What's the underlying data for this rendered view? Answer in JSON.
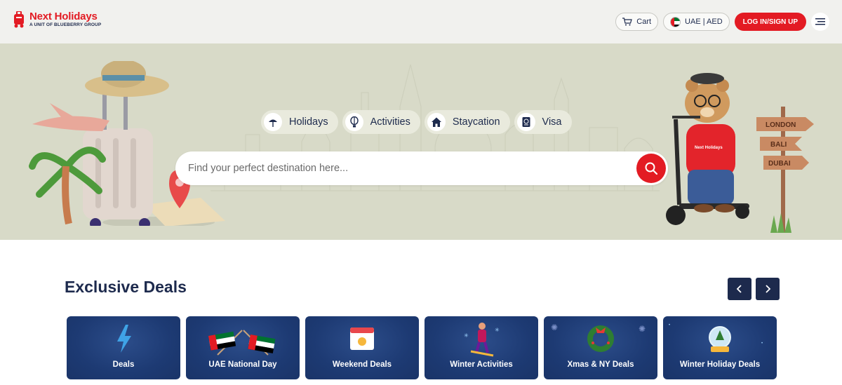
{
  "brand": {
    "name": "Next Holidays",
    "tagline": "A UNIT OF BLUEBERRY GROUP"
  },
  "header": {
    "cart_label": "Cart",
    "region_label": "UAE | AED",
    "login_label": "LOG IN/SIGN UP"
  },
  "hero": {
    "tabs": [
      {
        "label": "Holidays",
        "icon": "beach-umbrella-icon"
      },
      {
        "label": "Activities",
        "icon": "hot-air-balloon-icon"
      },
      {
        "label": "Staycation",
        "icon": "home-icon"
      },
      {
        "label": "Visa",
        "icon": "passport-icon"
      }
    ],
    "search": {
      "placeholder": "Find your perfect destination here..."
    },
    "signpost": [
      "LONDON",
      "BALI",
      "DUBAI"
    ],
    "mascot_shirt_text": "Next Holidays"
  },
  "deals": {
    "title": "Exclusive Deals",
    "cards": [
      {
        "label": "Deals",
        "icon": "lightning-icon"
      },
      {
        "label": "UAE National Day",
        "icon": "uae-flags-icon"
      },
      {
        "label": "Weekend Deals",
        "icon": "calendar-sun-icon"
      },
      {
        "label": "Winter Activities",
        "icon": "skier-icon"
      },
      {
        "label": "Xmas & NY Deals",
        "icon": "wreath-icon"
      },
      {
        "label": "Winter Holiday Deals",
        "icon": "snow-globe-icon"
      }
    ]
  },
  "colors": {
    "brand_red": "#e31b23",
    "navy": "#1d2a4d",
    "hero_bg": "#d8dac8",
    "card_bg": "#1d3a73"
  }
}
